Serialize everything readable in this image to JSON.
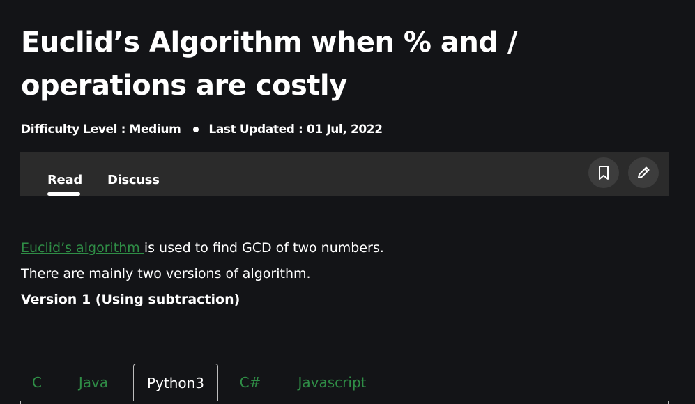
{
  "article": {
    "title": "Euclid’s Algorithm when % and / operations are costly",
    "difficulty_label": "Difficulty Level : Medium",
    "last_updated": "Last Updated : 01 Jul, 2022"
  },
  "tabbar": {
    "tabs": [
      {
        "label": "Read",
        "active": true
      },
      {
        "label": "Discuss",
        "active": false
      }
    ],
    "icons": [
      "bookmark-icon",
      "pencil-icon"
    ]
  },
  "content": {
    "link_text": "Euclid’s algorithm ",
    "para1_rest": "is used to find GCD of two numbers.",
    "para2": "There are mainly two versions of algorithm.",
    "heading": "Version 1 (Using subtraction)"
  },
  "code_tabs": {
    "tabs": [
      "C",
      "Java",
      "Python3",
      "C#",
      "Javascript"
    ],
    "active": "Python3"
  },
  "colors": {
    "background": "#131417",
    "tabbar": "#2b2b2b",
    "link_green": "#2f8d46"
  }
}
